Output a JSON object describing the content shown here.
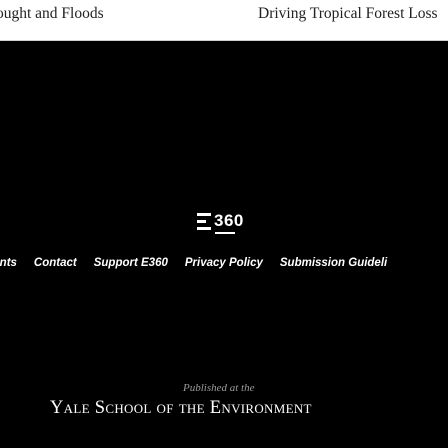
{
  "related": {
    "left_link": "ought and Floods",
    "right_link": "Driving Tropical Forest Loss"
  },
  "logo": {
    "text": "360",
    "label": "E360"
  },
  "footer_nav": [
    {
      "label": "rints"
    },
    {
      "label": "Contact"
    },
    {
      "label": "Support E360"
    },
    {
      "label": "Privacy Policy"
    },
    {
      "label": "Submission Guideli"
    }
  ],
  "publisher": {
    "published_at": "Published at the",
    "name": "Yale School of the Environment"
  },
  "colors": {
    "background": "#000000",
    "text": "#ffffff",
    "muted": "#9a9a9a"
  }
}
